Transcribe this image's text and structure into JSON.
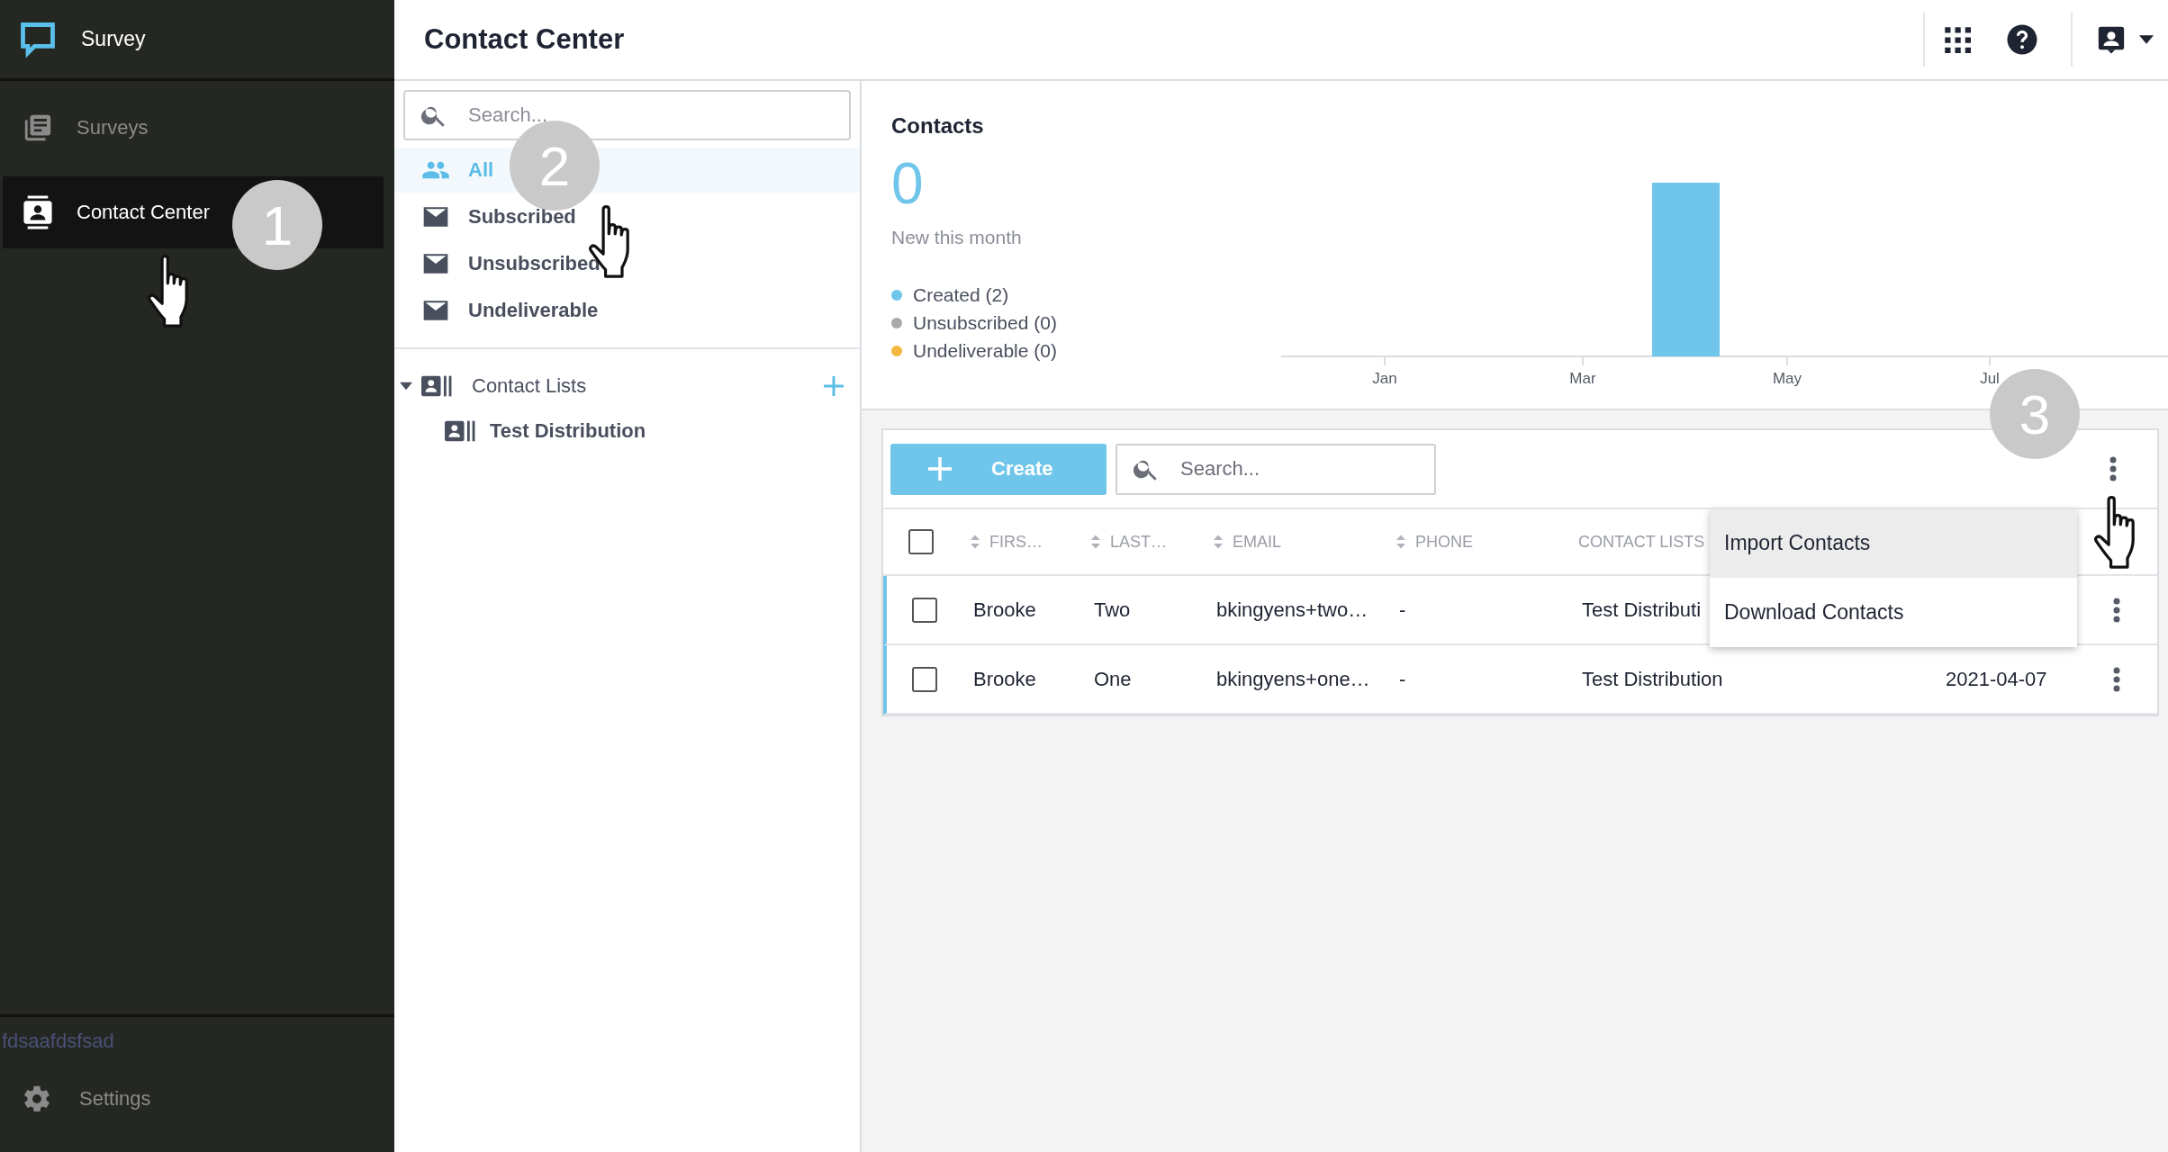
{
  "sidebar": {
    "app_name": "Survey",
    "items": [
      {
        "label": "Surveys",
        "selected": false,
        "kind": "surveys"
      },
      {
        "label": "Contact Center",
        "selected": true,
        "kind": "contacts"
      }
    ],
    "footer_text": "fdsaafdsfsad",
    "settings": "Settings"
  },
  "header": {
    "title": "Contact Center"
  },
  "nav": {
    "search": {
      "placeholder": "Search..."
    },
    "filters": [
      {
        "label": "All",
        "selected": true,
        "kind": "people"
      },
      {
        "label": "Subscribed",
        "selected": false,
        "kind": "mail"
      },
      {
        "label": "Unsubscribed",
        "selected": false,
        "kind": "mail"
      },
      {
        "label": "Undeliverable",
        "selected": false,
        "kind": "mail"
      }
    ],
    "contact_lists": {
      "label": "Contact Lists",
      "expanded": true,
      "items": [
        {
          "label": "Test Distribution"
        }
      ]
    }
  },
  "summary": {
    "title": "Contacts",
    "count": "0",
    "caption": "New this month",
    "legend": [
      {
        "label": "Created (2)",
        "color": "#6fc6ea"
      },
      {
        "label": "Unsubscribed (0)",
        "color": "#a9a9a9"
      },
      {
        "label": "Undeliverable (0)",
        "color": "#f2b73c"
      }
    ],
    "chart": {
      "x_labels": [
        "Jan",
        "Mar",
        "May",
        "Jul"
      ]
    }
  },
  "table": {
    "create_label": "Create",
    "search": {
      "placeholder": "Search..."
    },
    "select_all_checked": false,
    "columns": [
      {
        "label": "FIRS…",
        "sortable": true
      },
      {
        "label": "LAST…",
        "sortable": true
      },
      {
        "label": "EMAIL",
        "sortable": true
      },
      {
        "label": "PHONE",
        "sortable": true
      },
      {
        "label": "CONTACT LISTS",
        "sortable": false
      }
    ],
    "rows": [
      {
        "checked": false,
        "first": "Brooke",
        "last": "Two",
        "email": "bkingyens+two…",
        "phone": "-",
        "contact_lists": "Test Distributi"
      },
      {
        "checked": false,
        "first": "Brooke",
        "last": "One",
        "email": "bkingyens+one…",
        "phone": "-",
        "contact_lists": "Test Distribution",
        "date": "2021-04-07"
      }
    ],
    "menu": [
      {
        "label": "Import Contacts",
        "selected": true
      },
      {
        "label": "Download Contacts",
        "selected": false
      }
    ]
  },
  "callouts": [
    "1",
    "2",
    "3"
  ]
}
